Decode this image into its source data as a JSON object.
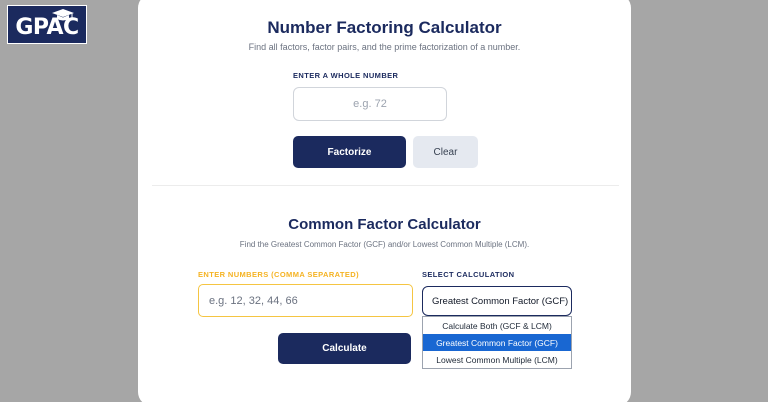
{
  "logo": {
    "text": "GPAC",
    "icon": "graduation-cap-icon",
    "background": "#1b2a5e"
  },
  "factoring": {
    "title": "Number Factoring Calculator",
    "subtitle": "Find all factors, factor pairs, and the prime factorization of a number.",
    "input_label": "ENTER A WHOLE NUMBER",
    "input_placeholder": "e.g. 72",
    "input_value": "",
    "factorize_label": "Factorize",
    "clear_label": "Clear"
  },
  "common": {
    "title": "Common Factor Calculator",
    "subtitle": "Find the Greatest Common Factor (GCF) and/or Lowest Common Multiple (LCM).",
    "numbers_label": "ENTER NUMBERS (COMMA SEPARATED)",
    "numbers_placeholder": "e.g. 12, 32, 44, 66",
    "numbers_value": "",
    "select_label": "SELECT CALCULATION",
    "selected_value": "Greatest Common Factor (GCF)",
    "options": [
      {
        "label": "Calculate Both (GCF & LCM)"
      },
      {
        "label": "Greatest Common Factor (GCF)"
      },
      {
        "label": "Lowest Common Multiple (LCM)"
      }
    ],
    "calculate_label": "Calculate"
  },
  "colors": {
    "primary": "#1b2a5e",
    "accent": "#f5b323",
    "highlight": "#1967d2",
    "background": "#a6a6a6"
  }
}
